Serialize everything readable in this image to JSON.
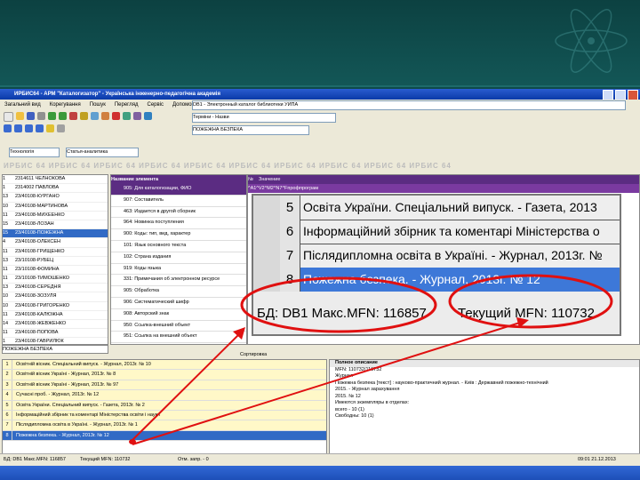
{
  "window": {
    "title": "ИРБИС64 - АРМ \"Каталогизатор\" - Українська інженерно-педагогічна академія"
  },
  "menu": [
    "Загальний вид",
    "Корегування",
    "Пошук",
    "Перегляд",
    "Сервіс",
    "Допомога"
  ],
  "database_selector": "DB1 - Электронный каталог библиотеки УИПА",
  "search": {
    "query": "ПОЖЕЖНА БЕЗПЕКА",
    "term_field": "Терміни - Назви"
  },
  "worksheet": {
    "type": "Технологія",
    "mode": "Статья-аналитика"
  },
  "watermark": "ИРБИС 64     ИРБИС 64     ИРБИС 64     ИРБИС 64     ИРБИС 64     ИРБИС 64     ИРБИС 64     ИРБИС 64     ИРБИС 64     ИРБИС 64",
  "left_list": {
    "rows": [
      {
        "n": "1",
        "text": "2314611 ЧЕЛНОКОВА"
      },
      {
        "n": "1",
        "text": "2314002 ПАВЛОВА"
      },
      {
        "n": "13",
        "text": "23/40108-КУРГАНО"
      },
      {
        "n": "10",
        "text": "23/40108-МАРТИНОВА"
      },
      {
        "n": "11",
        "text": "23/40108-МИХЕЕНКО"
      },
      {
        "n": "15",
        "text": "23/40108-ЛОЗАН"
      },
      {
        "n": "15",
        "text": "23/40108-ПОЖЕЖНА",
        "selected": true
      },
      {
        "n": "4",
        "text": "23/40108-ОЛЕКСЕН"
      },
      {
        "n": "11",
        "text": "23/40108-ГРИЩЕНКО"
      },
      {
        "n": "13",
        "text": "23/10108-РУБЕЦ"
      },
      {
        "n": "11",
        "text": "23/10108-ФОМИНА"
      },
      {
        "n": "11",
        "text": "23/10108-ТИМОШЕНКО"
      },
      {
        "n": "13",
        "text": "23/40108-СЕРЕДНЯ"
      },
      {
        "n": "10",
        "text": "23/40108-ЗОЗУЛЯ"
      },
      {
        "n": "10",
        "text": "23/40108-ГРИГОРЕНКО"
      },
      {
        "n": "11",
        "text": "23/40108-КАЛЮЖНА"
      },
      {
        "n": "14",
        "text": "23/40108-ЖЕВЖЕНКО"
      },
      {
        "n": "11",
        "text": "23/40108-ПОПОВА"
      },
      {
        "n": "1",
        "text": "23/40108-ГАВРИЛЮК"
      },
      {
        "n": "1",
        "text": "23/40108-ЯКОВЛЕВА"
      }
    ],
    "input": "ПОЖЕЖНА БЕЗПЕКА"
  },
  "fields": {
    "header": "Название элемента",
    "rows": [
      "905: Для каталогизации, ФИО",
      "907: Составитель",
      "463: Издается в другой сборник",
      "964: Новинка поступления",
      "900: Коды: тип, вид, характер",
      "101: Язык основного текста",
      "102: Страна издания",
      "919: Коды языка",
      "331: Примечания об электронном ресурсе",
      "905: Обработка",
      "906: Систематический шифр",
      "908: Авторский знак",
      "950: Ссылка-внешний объект",
      "951: Ссылка на внешний объект",
      "200: Заглавие"
    ]
  },
  "values": {
    "header_num": "№",
    "header_val": "Значение",
    "first_value": "^A1^V2^M2^N7^Fпрофпрограм"
  },
  "zoom": {
    "rows": [
      {
        "n": "5",
        "text": "Освіта України. Спеціальний випуск. - Газета, 2013"
      },
      {
        "n": "6",
        "text": "Інформаційний збірник та коментарі Міністерства о"
      },
      {
        "n": "7",
        "text": "Післядипломна освіта в Україні. - Журнал, 2013г. №"
      },
      {
        "n": "8",
        "text": "Пожежна безпека. - Журнал, 2013г. № 12",
        "selected": true
      }
    ],
    "db_info": "БД: DB1 Макс.MFN: 116857",
    "current_mfn": "Текущий MFN: 110732"
  },
  "bottom_left": {
    "sort_label": "Сортировка",
    "rows": [
      {
        "n": "1",
        "text": "Освітній вісник. Спеціальний випуск. - Журнал, 2013г. № 10",
        "style": "y"
      },
      {
        "n": "2",
        "text": "Освітній вісник Україні - Журнал, 2013г. № 8",
        "style": "y"
      },
      {
        "n": "3",
        "text": "Освітній вісник Україні - Журнал, 2013г. № 97",
        "style": "y"
      },
      {
        "n": "4",
        "text": "Сучасні проб. - Журнал, 2013г. № 12",
        "style": "y"
      },
      {
        "n": "5",
        "text": "Освіта України. Спеціальний випуск. - Газета, 2013г. № 2",
        "style": "y"
      },
      {
        "n": "6",
        "text": "Інформаційний збірник та коментарі Міністерства освіти і науки",
        "style": "y"
      },
      {
        "n": "7",
        "text": "Післядипломна освіта в Україні. - Журнал, 2013г. № 1",
        "style": "y"
      },
      {
        "n": "8",
        "text": "Пожежна безпека. - Журнал, 2013г. № 12",
        "style": "sel"
      }
    ]
  },
  "bottom_right": {
    "header": "Полное описание",
    "lines": [
      "MFN: 110732/110732",
      "Журнал",
      "Пожежна безпека [текст] : науково-практичний журнал. - Київ : Державний пожежно-технічний",
      "2015. - Журнал зарахування",
      "2015. № 12",
      "Имеются экземпляры в отделах:",
      "всего - 10 (1)",
      "Свободны: 10 (1)"
    ]
  },
  "statusbar": {
    "db": "БД: DB1 Макс.MFN: 116857",
    "current": "Текущий MFN: 110732",
    "mode": "Отм. запр. - 0",
    "time": "09:01 21.12.2013"
  }
}
